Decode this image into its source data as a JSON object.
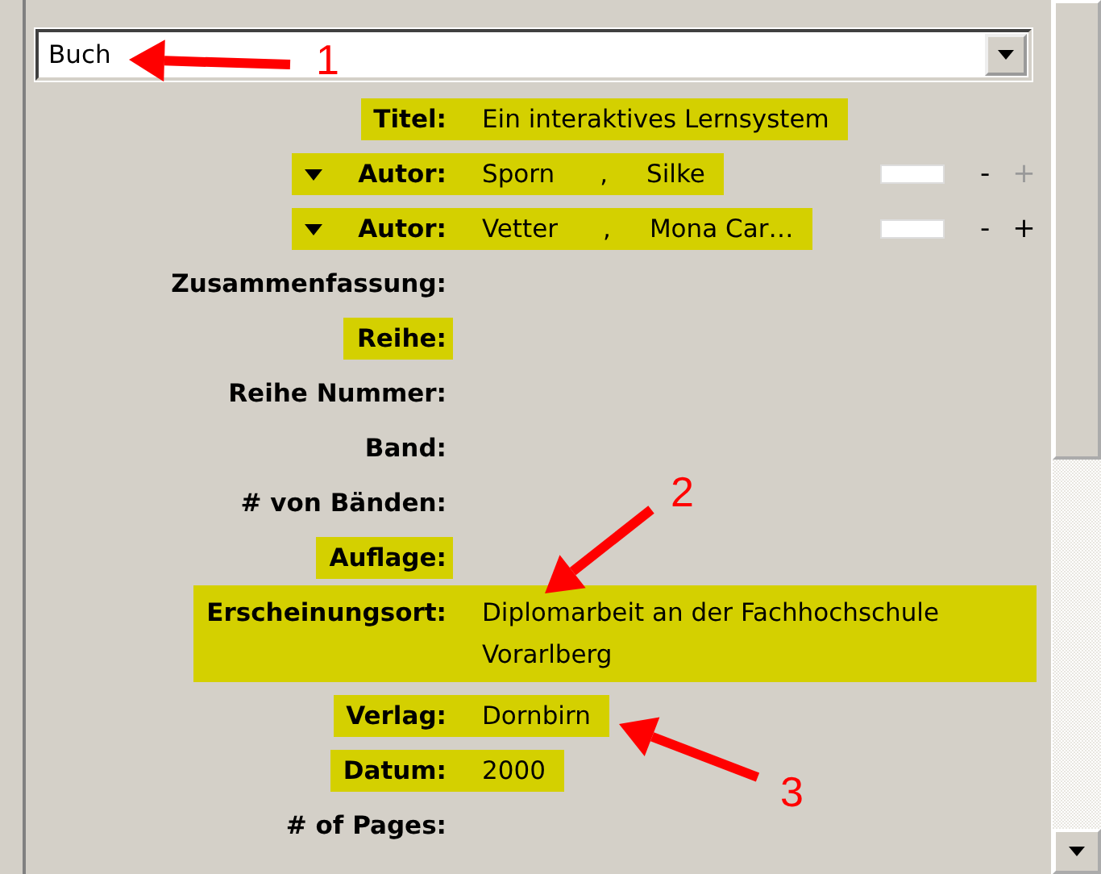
{
  "item_type": {
    "value": "Buch"
  },
  "fields": [
    {
      "kind": "text",
      "label": "Titel:",
      "value": "Ein interaktives Lernsystem",
      "highlighted": true
    },
    {
      "kind": "creator",
      "label": "Autor:",
      "last_name": "Sporn",
      "separator": ",",
      "first_name": "Silke",
      "highlighted": true,
      "remove": "-",
      "add": "+",
      "add_disabled": true
    },
    {
      "kind": "creator",
      "label": "Autor:",
      "last_name": "Vetter",
      "separator": ",",
      "first_name": "Mona Car…",
      "highlighted": true,
      "remove": "-",
      "add": "+",
      "add_disabled": false
    },
    {
      "kind": "text",
      "label": "Zusammenfassung:",
      "highlighted": false
    },
    {
      "kind": "text",
      "label": "Reihe:",
      "highlighted": true
    },
    {
      "kind": "text",
      "label": "Reihe Nummer:",
      "highlighted": false
    },
    {
      "kind": "text",
      "label": "Band:",
      "highlighted": false
    },
    {
      "kind": "text",
      "label": "# von Bänden:",
      "highlighted": false
    },
    {
      "kind": "text",
      "label": "Auflage:",
      "highlighted": true
    },
    {
      "kind": "text",
      "label": "Erscheinungsort:",
      "value": "Diplomarbeit an der Fachhochschule Vorarlberg",
      "highlighted": true
    },
    {
      "kind": "text",
      "label": "Verlag:",
      "value": "Dornbirn",
      "highlighted": true
    },
    {
      "kind": "text",
      "label": "Datum:",
      "value": "2000",
      "highlighted": true
    },
    {
      "kind": "text",
      "label": "# of Pages:",
      "highlighted": false
    }
  ],
  "annotations": [
    {
      "number": "1"
    },
    {
      "number": "2"
    },
    {
      "number": "3"
    }
  ]
}
